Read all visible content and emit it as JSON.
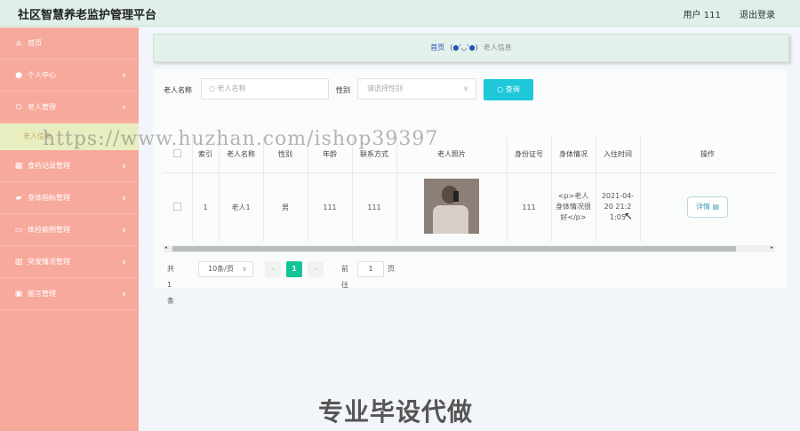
{
  "header": {
    "title": "社区智慧养老监护管理平台",
    "user": "用户 111",
    "logout": "退出登录"
  },
  "sidebar": {
    "items": [
      {
        "label": "首页",
        "icon": "home-icon",
        "glyph": "⌂",
        "chevron": ""
      },
      {
        "label": "个人中心",
        "icon": "user-icon",
        "glyph": "●",
        "chevron": "∨"
      },
      {
        "label": "老人管理",
        "icon": "power-icon",
        "glyph": "⏻",
        "chevron": "∧"
      },
      {
        "label": "老人信息",
        "icon": "",
        "glyph": "",
        "chevron": "",
        "sub": true
      },
      {
        "label": "食药记录管理",
        "icon": "grid-icon",
        "glyph": "▦",
        "chevron": "∨"
      },
      {
        "label": "身体指标管理",
        "icon": "briefcase-icon",
        "glyph": "▰",
        "chevron": "∨"
      },
      {
        "label": "体检病例管理",
        "icon": "message-icon",
        "glyph": "▭",
        "chevron": "∨"
      },
      {
        "label": "突发情况管理",
        "icon": "bar-chart-icon",
        "glyph": "▥",
        "chevron": "∨"
      },
      {
        "label": "留言管理",
        "icon": "document-icon",
        "glyph": "▣",
        "chevron": "∨"
      }
    ]
  },
  "breadcrumb": {
    "home": "首页",
    "sep": "(●'◡'●)",
    "current": "老人信息"
  },
  "search": {
    "name_label": "老人名称",
    "name_placeholder": "老人名称",
    "gender_label": "性别",
    "gender_placeholder": "请选择性别",
    "query_button": "查询"
  },
  "table": {
    "headers": [
      "",
      "索引",
      "老人名称",
      "性别",
      "年龄",
      "联系方式",
      "老人照片",
      "身份证号",
      "身体情况",
      "入住时间",
      "操作"
    ],
    "rows": [
      {
        "index": "1",
        "name": "老人1",
        "gender": "男",
        "age": "111",
        "contact": "111",
        "id_card": "111",
        "health": "<p>老人身体情况很好</p>",
        "checkin": "2021-04-20 21:21:05",
        "action": "详情"
      }
    ]
  },
  "pagination": {
    "total": "共 1 条",
    "page_size": "10条/页",
    "current": "1",
    "goto_label": "前往",
    "goto_value": "1",
    "page_unit": "页"
  },
  "watermark": "https://www.huzhan.com/ishop39397",
  "banner": "专业毕设代做"
}
